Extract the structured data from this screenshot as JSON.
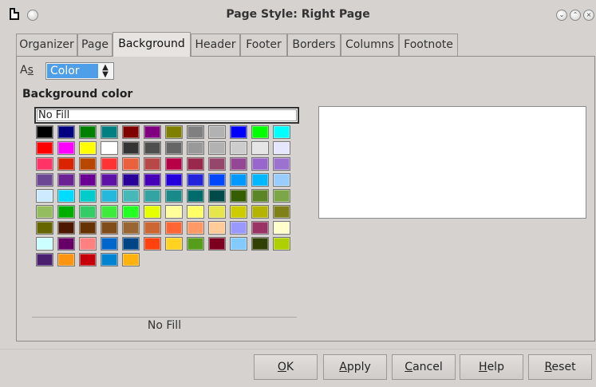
{
  "window": {
    "title": "Page Style: Right Page",
    "controls": [
      "minimize-icon",
      "maximize-icon",
      "close-icon"
    ]
  },
  "tabs": [
    {
      "label": "Organizer",
      "active": false
    },
    {
      "label": "Page",
      "active": false
    },
    {
      "label": "Background",
      "active": true
    },
    {
      "label": "Header",
      "active": false
    },
    {
      "label": "Footer",
      "active": false
    },
    {
      "label": "Borders",
      "active": false
    },
    {
      "label": "Columns",
      "active": false
    },
    {
      "label": "Footnote",
      "active": false
    }
  ],
  "as_field": {
    "label_pre": "A",
    "label_mnemonic": "s",
    "value": "Color"
  },
  "background_section": {
    "title": "Background color",
    "no_fill_option": "No Fill",
    "selected_color_name": "No Fill"
  },
  "palette": [
    [
      "#000000",
      "#000080",
      "#008000",
      "#008080",
      "#800000",
      "#800080",
      "#808000",
      "#808080",
      "#b2b2b2",
      "#0000ff",
      "#00ff00",
      "#00ffff"
    ],
    [
      "#ff0000",
      "#ff00ff",
      "#ffff00",
      "#ffffff",
      "#333333",
      "#4f4f4f",
      "#666666",
      "#999999",
      "#b2b2b2",
      "#cccccc",
      "#e5e5e5",
      "#e6e6ff"
    ],
    [
      "#ff3366",
      "#dc2300",
      "#b84700",
      "#ff3333",
      "#eb613d",
      "#b84747",
      "#b80047",
      "#99284c",
      "#94476b",
      "#944794",
      "#9966cc",
      "#9c72d0"
    ],
    [
      "#6b4794",
      "#6b2394",
      "#6b0094",
      "#5e11a6",
      "#280099",
      "#4700b8",
      "#2300dc",
      "#2323dc",
      "#0047ff",
      "#0099ff",
      "#00b8ff",
      "#99ccff"
    ],
    [
      "#ccebff",
      "#00dcff",
      "#00cccc",
      "#23b8dc",
      "#47b8b8",
      "#33a3a3",
      "#198a8a",
      "#006b6b",
      "#004a4a",
      "#355e00",
      "#5c8526",
      "#7da647"
    ],
    [
      "#94bd5e",
      "#00ae00",
      "#33cc66",
      "#3deb3d",
      "#23ff23",
      "#e6ff00",
      "#ffff99",
      "#ffff66",
      "#e6e64c",
      "#cccc00",
      "#b3b300",
      "#808019"
    ],
    [
      "#666600",
      "#4c1900",
      "#663300",
      "#804c19",
      "#996633",
      "#cc6633",
      "#ff6633",
      "#ff9966",
      "#ffcc99",
      "#9999ff",
      "#993366",
      "#ffffcc"
    ],
    [
      "#ccffff",
      "#660066",
      "#ff8080",
      "#0066cc",
      "#004586",
      "#ff420e",
      "#ffd320",
      "#579d1c",
      "#7e0021",
      "#83caff",
      "#314004",
      "#aecf00"
    ],
    [
      "#4b1f6f",
      "#ff950e",
      "#c5000b",
      "#0084d1",
      "#ffb20e"
    ]
  ],
  "buttons": [
    {
      "pre": "",
      "mnemonic": "O",
      "post": "K"
    },
    {
      "pre": "",
      "mnemonic": "A",
      "post": "pply"
    },
    {
      "pre": "",
      "mnemonic": "C",
      "post": "ancel"
    },
    {
      "pre": "",
      "mnemonic": "H",
      "post": "elp"
    },
    {
      "pre": "",
      "mnemonic": "R",
      "post": "eset"
    }
  ]
}
